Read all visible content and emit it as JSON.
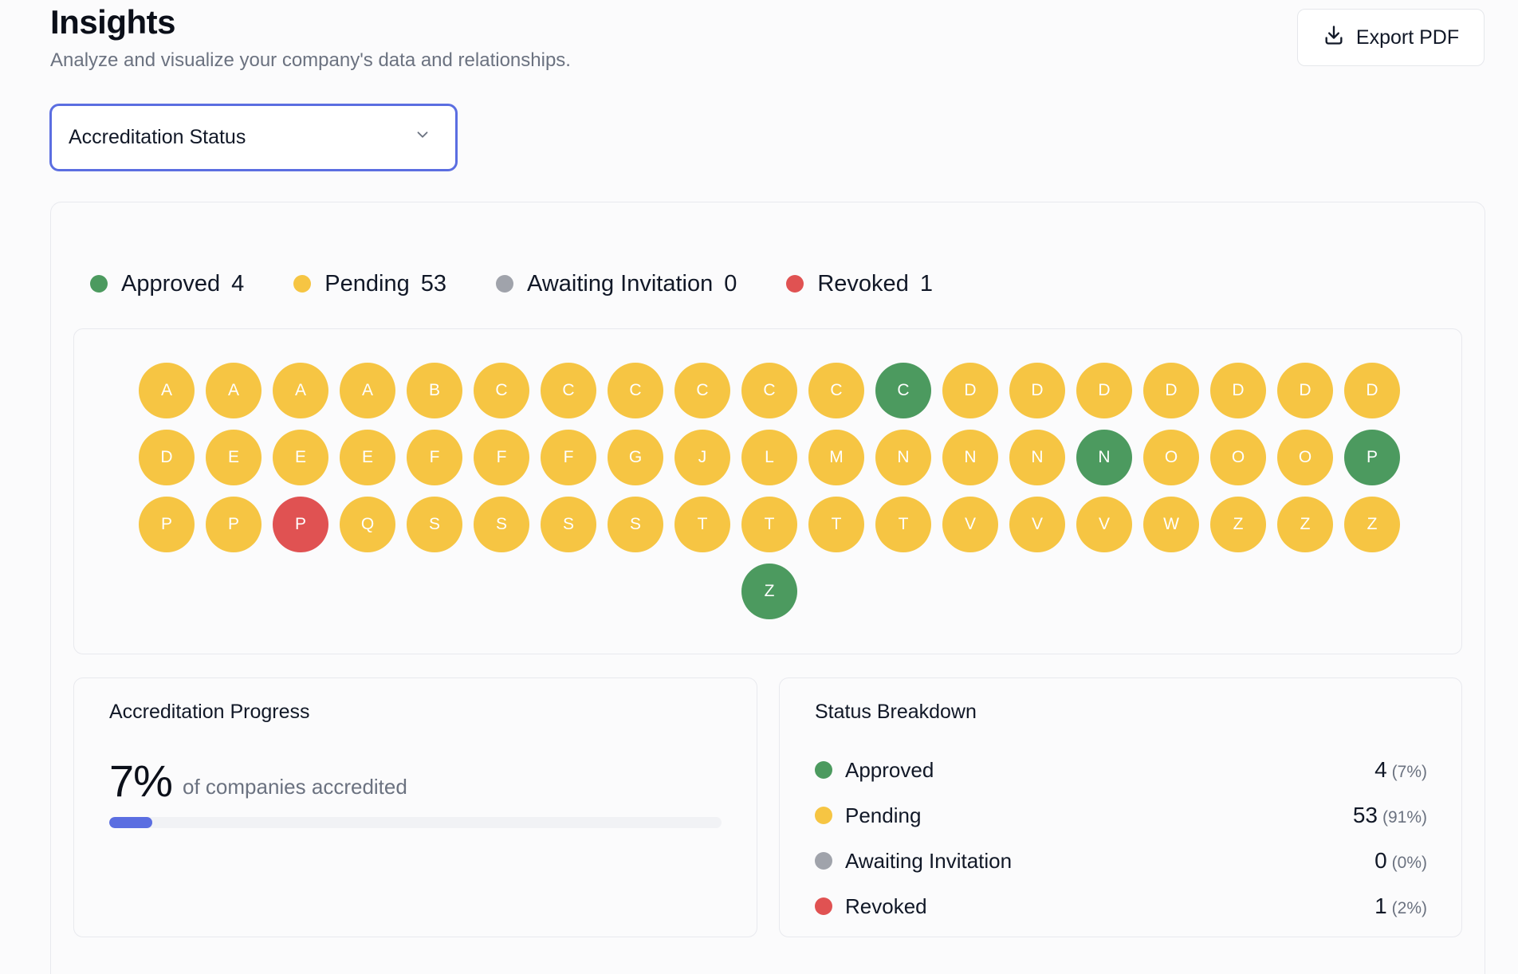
{
  "header": {
    "title": "Insights",
    "subtitle": "Analyze and visualize your company's data and relationships.",
    "export_label": "Export PDF"
  },
  "selector": {
    "value": "Accreditation Status"
  },
  "colors": {
    "approved": "#4c9a5f",
    "pending": "#f6c543",
    "awaiting": "#a0a3ab",
    "revoked": "#e05252",
    "accent": "#5b6ee1"
  },
  "legend": [
    {
      "key": "approved",
      "label": "Approved",
      "count": "4"
    },
    {
      "key": "pending",
      "label": "Pending",
      "count": "53"
    },
    {
      "key": "awaiting",
      "label": "Awaiting Invitation",
      "count": "0"
    },
    {
      "key": "revoked",
      "label": "Revoked",
      "count": "1"
    }
  ],
  "companies": [
    {
      "letter": "A",
      "status": "pending"
    },
    {
      "letter": "A",
      "status": "pending"
    },
    {
      "letter": "A",
      "status": "pending"
    },
    {
      "letter": "A",
      "status": "pending"
    },
    {
      "letter": "B",
      "status": "pending"
    },
    {
      "letter": "C",
      "status": "pending"
    },
    {
      "letter": "C",
      "status": "pending"
    },
    {
      "letter": "C",
      "status": "pending"
    },
    {
      "letter": "C",
      "status": "pending"
    },
    {
      "letter": "C",
      "status": "pending"
    },
    {
      "letter": "C",
      "status": "pending"
    },
    {
      "letter": "C",
      "status": "approved"
    },
    {
      "letter": "D",
      "status": "pending"
    },
    {
      "letter": "D",
      "status": "pending"
    },
    {
      "letter": "D",
      "status": "pending"
    },
    {
      "letter": "D",
      "status": "pending"
    },
    {
      "letter": "D",
      "status": "pending"
    },
    {
      "letter": "D",
      "status": "pending"
    },
    {
      "letter": "D",
      "status": "pending"
    },
    {
      "letter": "D",
      "status": "pending"
    },
    {
      "letter": "E",
      "status": "pending"
    },
    {
      "letter": "E",
      "status": "pending"
    },
    {
      "letter": "E",
      "status": "pending"
    },
    {
      "letter": "F",
      "status": "pending"
    },
    {
      "letter": "F",
      "status": "pending"
    },
    {
      "letter": "F",
      "status": "pending"
    },
    {
      "letter": "G",
      "status": "pending"
    },
    {
      "letter": "J",
      "status": "pending"
    },
    {
      "letter": "L",
      "status": "pending"
    },
    {
      "letter": "M",
      "status": "pending"
    },
    {
      "letter": "N",
      "status": "pending"
    },
    {
      "letter": "N",
      "status": "pending"
    },
    {
      "letter": "N",
      "status": "pending"
    },
    {
      "letter": "N",
      "status": "approved"
    },
    {
      "letter": "O",
      "status": "pending"
    },
    {
      "letter": "O",
      "status": "pending"
    },
    {
      "letter": "O",
      "status": "pending"
    },
    {
      "letter": "P",
      "status": "approved"
    },
    {
      "letter": "P",
      "status": "pending"
    },
    {
      "letter": "P",
      "status": "pending"
    },
    {
      "letter": "P",
      "status": "revoked"
    },
    {
      "letter": "Q",
      "status": "pending"
    },
    {
      "letter": "S",
      "status": "pending"
    },
    {
      "letter": "S",
      "status": "pending"
    },
    {
      "letter": "S",
      "status": "pending"
    },
    {
      "letter": "S",
      "status": "pending"
    },
    {
      "letter": "T",
      "status": "pending"
    },
    {
      "letter": "T",
      "status": "pending"
    },
    {
      "letter": "T",
      "status": "pending"
    },
    {
      "letter": "T",
      "status": "pending"
    },
    {
      "letter": "V",
      "status": "pending"
    },
    {
      "letter": "V",
      "status": "pending"
    },
    {
      "letter": "V",
      "status": "pending"
    },
    {
      "letter": "W",
      "status": "pending"
    },
    {
      "letter": "Z",
      "status": "pending"
    },
    {
      "letter": "Z",
      "status": "pending"
    },
    {
      "letter": "Z",
      "status": "pending"
    },
    {
      "letter": "Z",
      "status": "approved"
    }
  ],
  "progress": {
    "title": "Accreditation Progress",
    "percent_label": "7%",
    "caption": "of companies accredited",
    "fraction": 0.07
  },
  "breakdown": {
    "title": "Status Breakdown",
    "rows": [
      {
        "key": "approved",
        "label": "Approved",
        "count": "4",
        "pct": "(7%)"
      },
      {
        "key": "pending",
        "label": "Pending",
        "count": "53",
        "pct": "(91%)"
      },
      {
        "key": "awaiting",
        "label": "Awaiting Invitation",
        "count": "0",
        "pct": "(0%)"
      },
      {
        "key": "revoked",
        "label": "Revoked",
        "count": "1",
        "pct": "(2%)"
      }
    ]
  }
}
